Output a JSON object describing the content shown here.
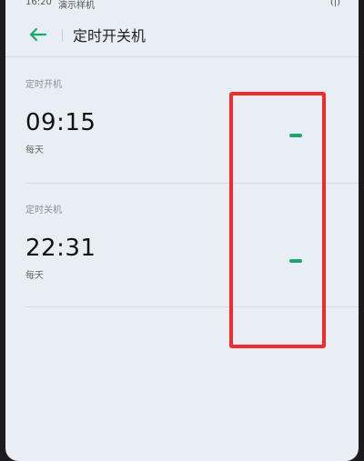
{
  "status_bar": {
    "time": "16:20",
    "carrier": "演示样机",
    "indicator": "(|)"
  },
  "header": {
    "back_icon": "arrow-left-icon",
    "title": "定时开关机"
  },
  "power_on": {
    "section_label": "定时开机",
    "time": "09:15",
    "repeat": "每天",
    "enabled": true
  },
  "power_off": {
    "section_label": "定时关机",
    "time": "22:31",
    "repeat": "每天",
    "enabled": true
  },
  "colors": {
    "accent": "#1aa86a",
    "highlight": "#ef2b2b",
    "background": "#e9edf4"
  }
}
